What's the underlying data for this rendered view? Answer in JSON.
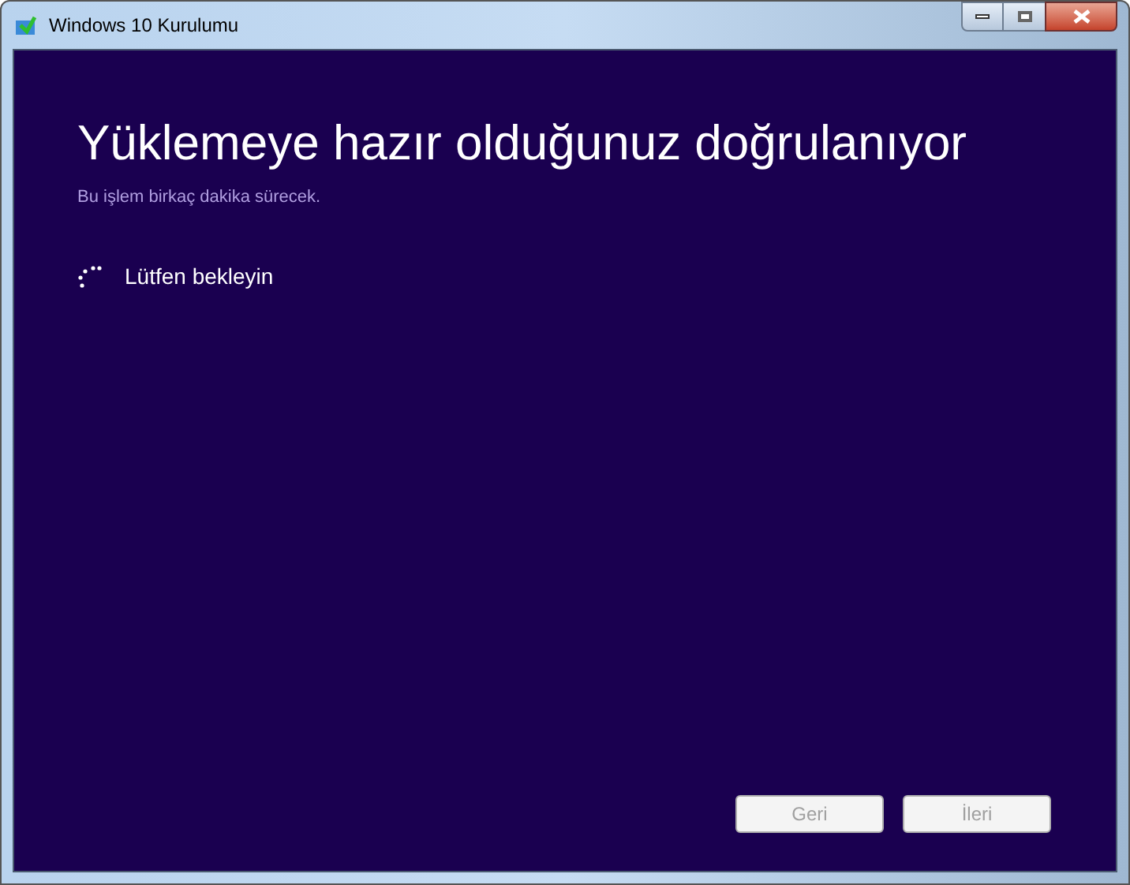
{
  "window": {
    "title": "Windows 10 Kurulumu"
  },
  "heading": "Yüklemeye hazır olduğunuz doğrulanıyor",
  "subtitle": "Bu işlem birkaç dakika sürecek.",
  "status": "Lütfen bekleyin",
  "buttons": [
    {
      "label": "Geri",
      "disabled": true
    },
    {
      "label": "İleri",
      "disabled": true
    }
  ]
}
